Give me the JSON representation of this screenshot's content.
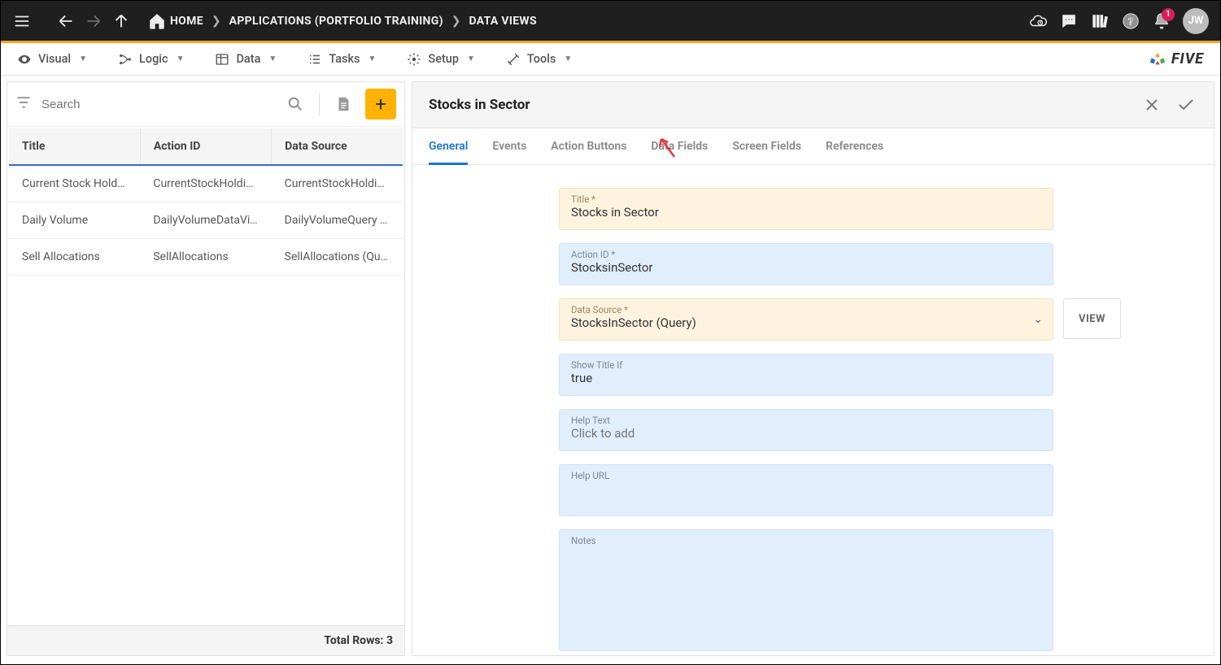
{
  "topbar": {
    "home": "HOME",
    "crumb1": "APPLICATIONS (PORTFOLIO TRAINING)",
    "crumb2": "DATA VIEWS",
    "notification_count": "1",
    "avatar": "JW"
  },
  "menubar": {
    "visual": "Visual",
    "logic": "Logic",
    "data": "Data",
    "tasks": "Tasks",
    "setup": "Setup",
    "tools": "Tools",
    "brand": "FIVE"
  },
  "left": {
    "search_placeholder": "Search",
    "cols": {
      "title": "Title",
      "action": "Action ID",
      "source": "Data Source"
    },
    "rows": [
      {
        "t": "Current Stock Holdi…",
        "a": "CurrentStockHolding",
        "s": "CurrentStockHoldin…"
      },
      {
        "t": "Daily Volume",
        "a": "DailyVolumeDataVi…",
        "s": "DailyVolumeQuery …"
      },
      {
        "t": "Sell Allocations",
        "a": "SellAllocations",
        "s": "SellAllocations (Qu…"
      }
    ],
    "footer": "Total Rows: 3"
  },
  "right": {
    "title": "Stocks in Sector",
    "tabs": {
      "general": "General",
      "events": "Events",
      "actionbtns": "Action Buttons",
      "datafields": "Data Fields",
      "screenfields": "Screen Fields",
      "references": "References"
    },
    "view_btn": "VIEW",
    "fields": {
      "title_lab": "Title *",
      "title_val": "Stocks in Sector",
      "action_lab": "Action ID *",
      "action_val": "StocksinSector",
      "source_lab": "Data Source *",
      "source_val": "StocksInSector (Query)",
      "showif_lab": "Show Title If",
      "showif_val": "true",
      "help_lab": "Help Text",
      "help_val": "Click to add",
      "helpurl_lab": "Help URL",
      "helpurl_val": "",
      "notes_lab": "Notes",
      "notes_val": ""
    }
  }
}
